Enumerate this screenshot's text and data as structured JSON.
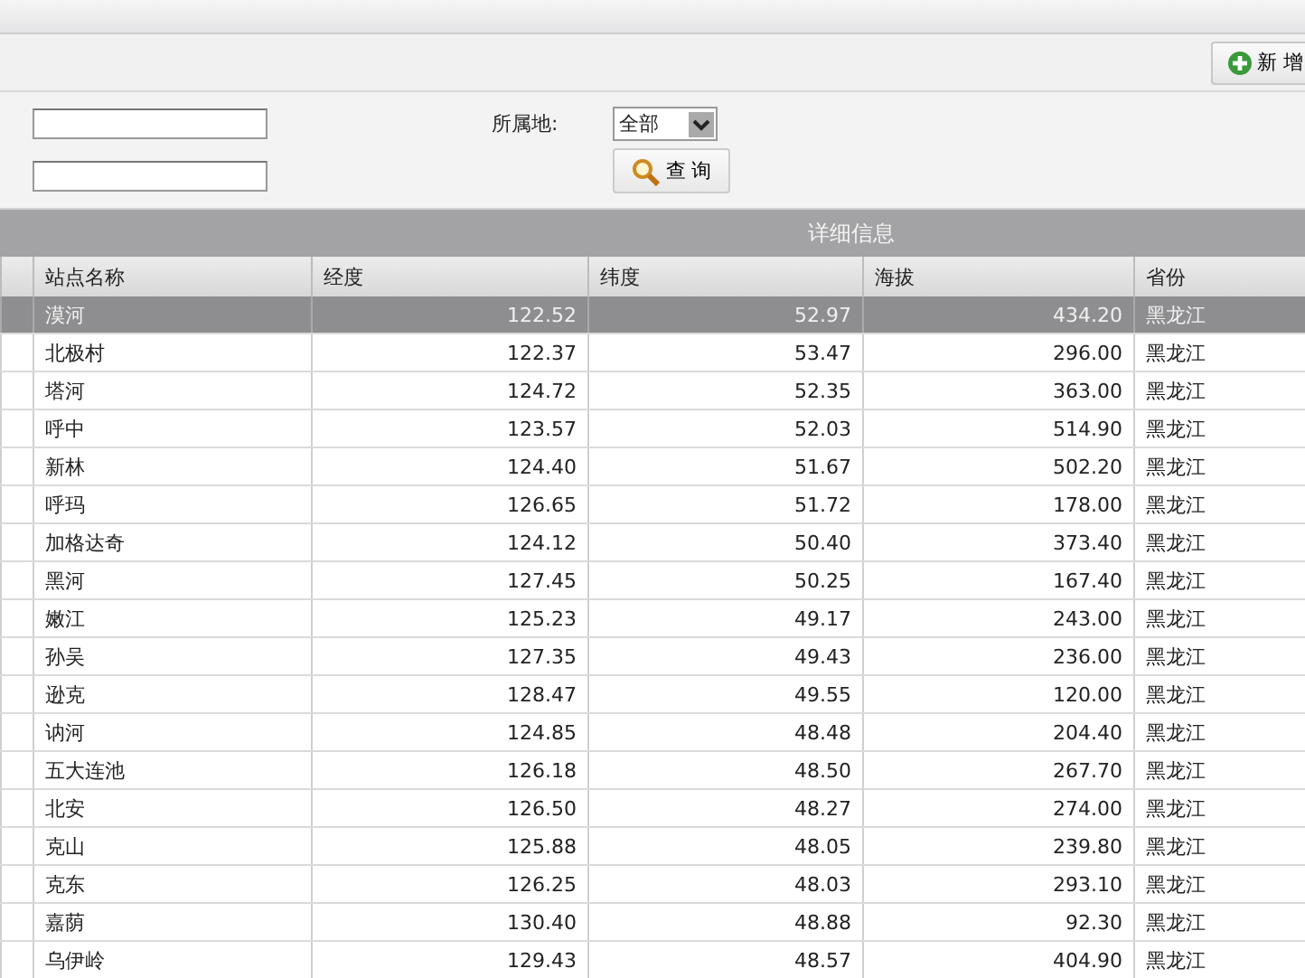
{
  "toolbar": {
    "add_button": "新 增"
  },
  "filters": {
    "fields": [
      {
        "kind": "text"
      },
      {
        "kind": "text"
      }
    ],
    "region_label": "所属地:",
    "region_select": "全部",
    "query_button": "查 询"
  },
  "table": {
    "group_header": "详细信息",
    "columns": [
      "站点名称",
      "经度",
      "纬度",
      "海拔",
      "省份"
    ],
    "rows": [
      {
        "cells": [
          "漠河",
          "122.52",
          "52.97",
          "434.20",
          "黑龙江"
        ],
        "selected": true
      },
      {
        "cells": [
          "北极村",
          "122.37",
          "53.47",
          "296.00",
          "黑龙江"
        ],
        "selected": false
      },
      {
        "cells": [
          "塔河",
          "124.72",
          "52.35",
          "363.00",
          "黑龙江"
        ],
        "selected": false
      },
      {
        "cells": [
          "呼中",
          "123.57",
          "52.03",
          "514.90",
          "黑龙江"
        ],
        "selected": false
      },
      {
        "cells": [
          "新林",
          "124.40",
          "51.67",
          "502.20",
          "黑龙江"
        ],
        "selected": false
      },
      {
        "cells": [
          "呼玛",
          "126.65",
          "51.72",
          "178.00",
          "黑龙江"
        ],
        "selected": false
      },
      {
        "cells": [
          "加格达奇",
          "124.12",
          "50.40",
          "373.40",
          "黑龙江"
        ],
        "selected": false
      },
      {
        "cells": [
          "黑河",
          "127.45",
          "50.25",
          "167.40",
          "黑龙江"
        ],
        "selected": false
      },
      {
        "cells": [
          "嫩江",
          "125.23",
          "49.17",
          "243.00",
          "黑龙江"
        ],
        "selected": false
      },
      {
        "cells": [
          "孙吴",
          "127.35",
          "49.43",
          "236.00",
          "黑龙江"
        ],
        "selected": false
      },
      {
        "cells": [
          "逊克",
          "128.47",
          "49.55",
          "120.00",
          "黑龙江"
        ],
        "selected": false
      },
      {
        "cells": [
          "讷河",
          "124.85",
          "48.48",
          "204.40",
          "黑龙江"
        ],
        "selected": false
      },
      {
        "cells": [
          "五大连池",
          "126.18",
          "48.50",
          "267.70",
          "黑龙江"
        ],
        "selected": false
      },
      {
        "cells": [
          "北安",
          "126.50",
          "48.27",
          "274.00",
          "黑龙江"
        ],
        "selected": false
      },
      {
        "cells": [
          "克山",
          "125.88",
          "48.05",
          "239.80",
          "黑龙江"
        ],
        "selected": false
      },
      {
        "cells": [
          "克东",
          "126.25",
          "48.03",
          "293.10",
          "黑龙江"
        ],
        "selected": false
      },
      {
        "cells": [
          "嘉荫",
          "130.40",
          "48.88",
          "92.30",
          "黑龙江"
        ],
        "selected": false
      },
      {
        "cells": [
          "乌伊岭",
          "129.43",
          "48.57",
          "404.90",
          "黑龙江"
        ],
        "selected": false
      }
    ]
  }
}
